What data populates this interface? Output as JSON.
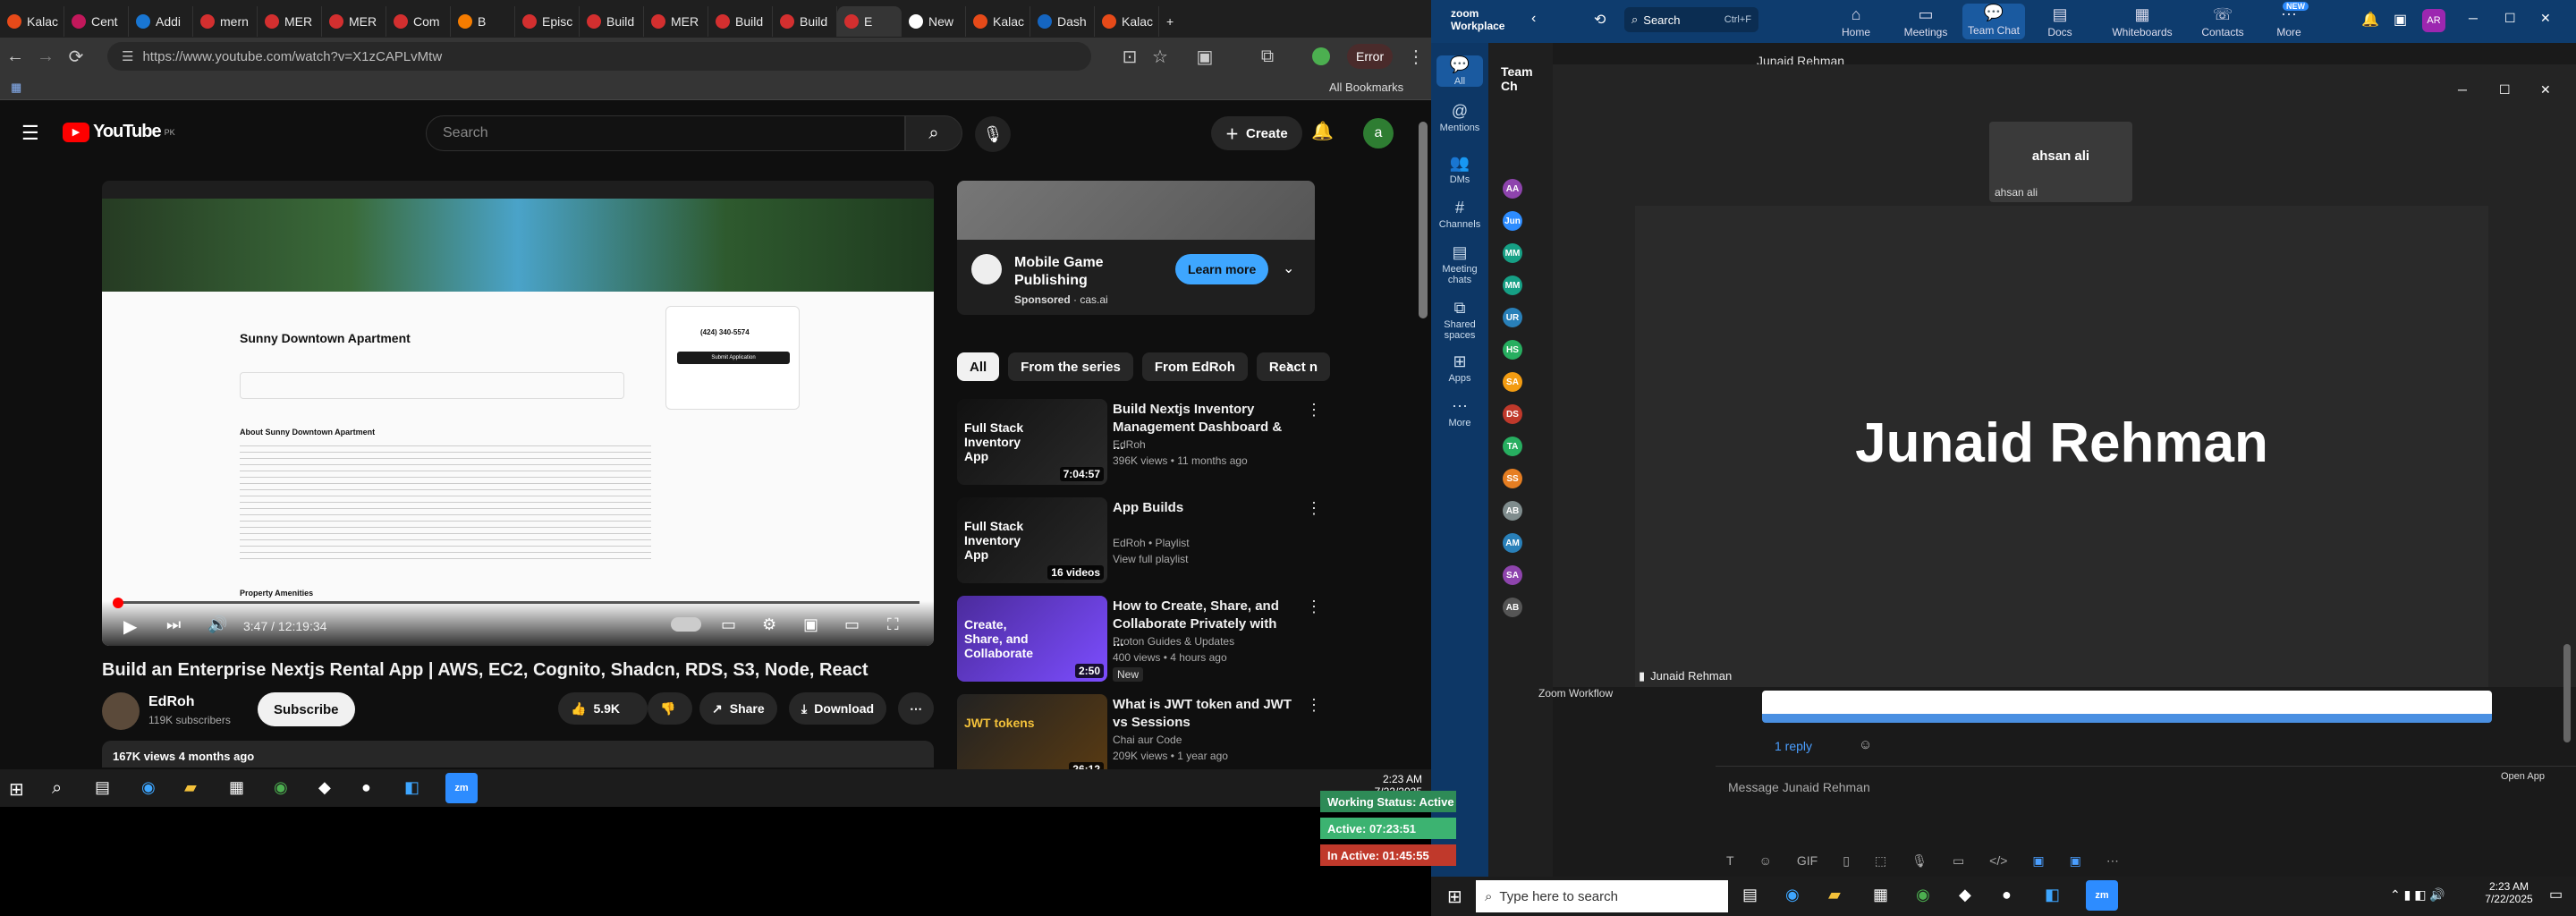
{
  "browser": {
    "tabs": [
      "Kalac",
      "Cent",
      "Addi",
      "mern",
      "MER",
      "MER",
      "Com",
      "B",
      "Episc",
      "Build",
      "MER",
      "Build",
      "Build",
      "E",
      "New",
      "Kalac",
      "Dash",
      "Kalac"
    ],
    "url": "https://www.youtube.com/watch?v=X1zCAPLvMtw",
    "all_bookmarks": "All Bookmarks",
    "error_label": "Error"
  },
  "youtube": {
    "logo": "YouTube",
    "region": "PK",
    "search_placeholder": "Search",
    "create_label": "Create",
    "avatar": "a",
    "video": {
      "title": "Build an Enterprise Nextjs Rental App | AWS, EC2, Cognito, Shadcn, RDS, S3, Node, React",
      "time": "3:47 / 12:19:34",
      "page_title": "Sunny Downtown Apartment",
      "page_subtitle": "About Sunny Downtown Apartment",
      "phone": "(424) 340-5574",
      "submit": "Submit Application",
      "amenities": "Property Amenities"
    },
    "channel": {
      "name": "EdRoh",
      "subs": "119K subscribers",
      "subscribe": "Subscribe"
    },
    "actions": {
      "likes": "5.9K",
      "share": "Share",
      "download": "Download"
    },
    "views_line": "167K views  4 months ago",
    "ad": {
      "title": "Mobile Game Publishing",
      "sponsor": "Sponsored",
      "domain": "cas.ai",
      "cta": "Learn more"
    },
    "chips": [
      "All",
      "From the series",
      "From EdRoh",
      "React n"
    ],
    "recs": [
      {
        "title": "Build Nextjs Inventory Management Dashboard & ...",
        "meta1": "EdRoh",
        "meta2": "396K views • 11 months ago",
        "dur": "7:04:57",
        "thumb": "Full Stack Inventory App"
      },
      {
        "title": "App Builds",
        "meta1": "EdRoh • Playlist",
        "meta2": "View full playlist",
        "dur": "16 videos",
        "thumb": "Full Stack Inventory App"
      },
      {
        "title": "How to Create, Share, and Collaborate Privately with ...",
        "meta1": "Proton Guides & Updates",
        "meta2": "400 views • 4 hours ago",
        "badge": "New",
        "dur": "2:50",
        "thumb": "Create, Share, and Collaborate"
      },
      {
        "title": "What is JWT token and JWT vs Sessions",
        "meta1": "Chai aur Code",
        "meta2": "209K views • 1 year ago",
        "dur": "26:12",
        "thumb": "JWT tokens"
      }
    ]
  },
  "taskbar_left": {
    "time": "2:23 AM",
    "date": "7/22/2025"
  },
  "zoom": {
    "brand": "zoom Workplace",
    "search": "Search",
    "shortcut": "Ctrl+F",
    "tabs": [
      "Home",
      "Meetings",
      "Team Chat",
      "Docs",
      "Whiteboards",
      "Contacts",
      "More"
    ],
    "new_badge": "NEW",
    "rail": [
      "All",
      "Mentions",
      "DMs",
      "Channels",
      "Meeting chats",
      "Shared spaces",
      "Apps",
      "More"
    ],
    "list_header": "Team Ch",
    "contacts": [
      "AA",
      "Jun",
      "MM",
      "MM",
      "UR",
      "HS",
      "SA",
      "DS",
      "TA",
      "SS",
      "AB",
      "AM",
      "SA",
      "AB"
    ],
    "workflow": "Zoom Workflow",
    "chat_header": "Junaid Rehman",
    "meeting": {
      "small_name": "ahsan ali",
      "small_label": "ahsan ali",
      "main_name": "Junaid Rehman",
      "main_label": "Junaid Rehman"
    },
    "reply": "1 reply",
    "message_placeholder": "Message Junaid Rehman",
    "open_app": "Open App",
    "status": {
      "working": "Working Status: Active",
      "active": "Active: 07:23:51",
      "inactive": "In Active: 01:45:55"
    }
  },
  "taskbar_right": {
    "search": "Type here to search",
    "time": "2:23 AM",
    "date": "7/22/2025"
  }
}
